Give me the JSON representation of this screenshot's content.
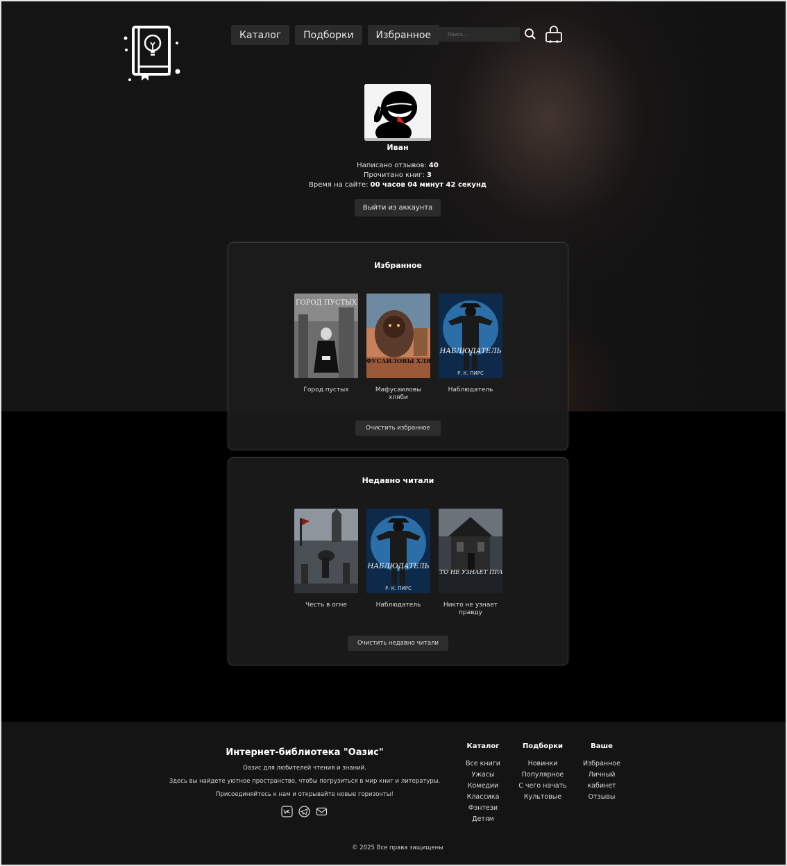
{
  "nav": {
    "items": [
      {
        "label": "Каталог"
      },
      {
        "label": "Подборки"
      },
      {
        "label": "Избранное"
      }
    ],
    "search_placeholder": "Поиск...",
    "icons": {
      "search": "search-icon",
      "cart": "cart-icon",
      "logo": "book-lightbulb-logo"
    }
  },
  "profile": {
    "name": "Иван",
    "reviews_label": "Написано отзывов:",
    "reviews_value": "40",
    "books_read_label": "Прочитано книг:",
    "books_read_value": "3",
    "time_label": "Время на сайте:",
    "time_value": "00 часов 04 минут 42 секунд",
    "logout_label": "Выйти из аккаунта"
  },
  "favorites": {
    "title": "Избранное",
    "books": [
      {
        "title": "Город пустых",
        "cover_text": "ГОРОД ПУСТЫХ"
      },
      {
        "title": "Мафусаиловы хляби",
        "cover_text": "МАФУСАИЛОВЫ ХЛЯБИ"
      },
      {
        "title": "Наблюдатель",
        "cover_text": "НАБЛЮДАТЕЛЬ",
        "author_text": "Р. К. ПИРС"
      }
    ],
    "clear_label": "Очистить избранное"
  },
  "recent": {
    "title": "Недавно читали",
    "books": [
      {
        "title": "Честь в огне"
      },
      {
        "title": "Наблюдатель",
        "cover_text": "НАБЛЮДАТЕЛЬ",
        "author_text": "Р. К. ПИРС"
      },
      {
        "title": "Никто не узнает правду",
        "cover_text": "НИКТО НЕ УЗНАЕТ ПРАВДУ"
      }
    ],
    "clear_label": "Очистить недавно читали"
  },
  "footer": {
    "title": "Интернет-библиотека \"Оазис\"",
    "line1": "Оазис для любителей чтения и знаний.",
    "line2": "Здесь вы найдете уютное пространство, чтобы погрузиться в мир книг и литературы.",
    "line3": "Присоединяйтесь к нам и открывайте новые горизонты!",
    "socials": [
      "vk-icon",
      "telegram-icon",
      "mail-icon"
    ],
    "columns": [
      {
        "heading": "Каталог",
        "items": [
          "Все книги",
          "Ужасы",
          "Комедии",
          "Классика",
          "Фэнтези",
          "Детям"
        ]
      },
      {
        "heading": "Подборки",
        "items": [
          "Новинки",
          "Популярное",
          "С чего начать",
          "Культовые"
        ]
      },
      {
        "heading": "Ваше",
        "items": [
          "Избранное",
          "Личный кабинет",
          "Отзывы"
        ]
      }
    ],
    "copyright": "© 2025 Все права защищены"
  }
}
